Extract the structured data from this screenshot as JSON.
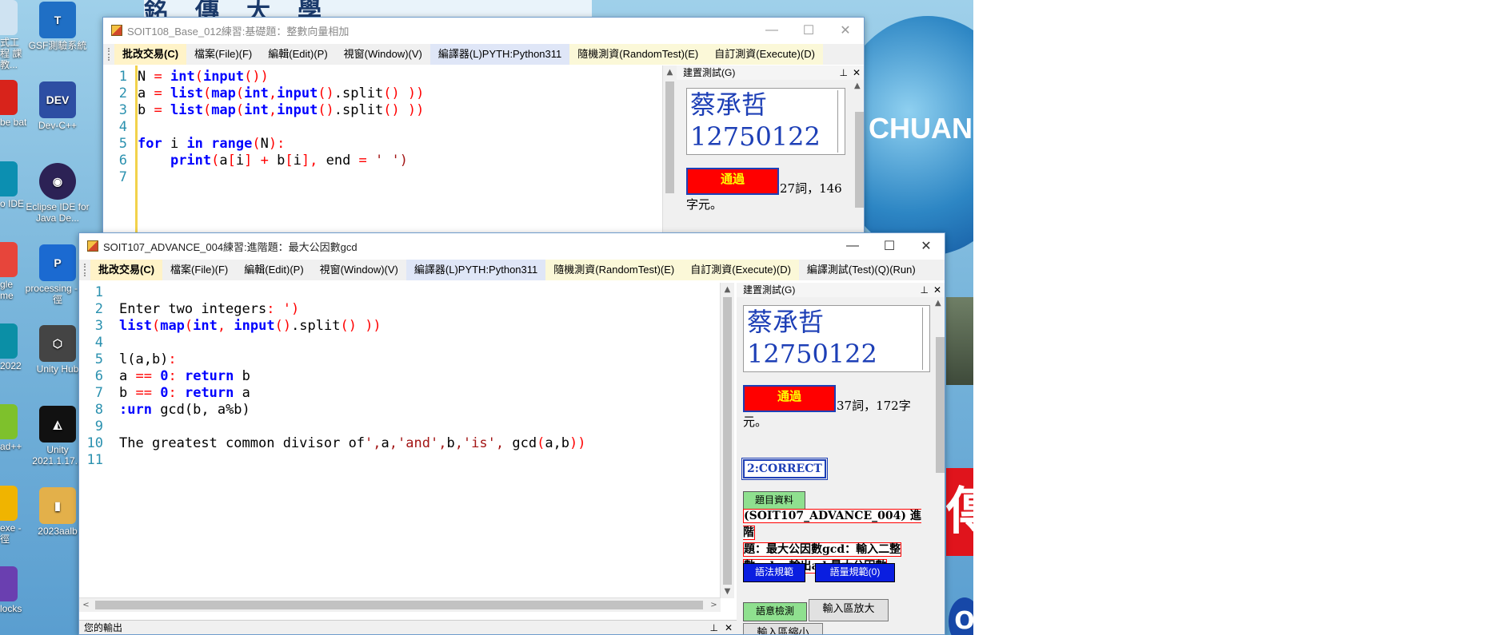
{
  "desktop": {
    "banner": "銘傳大學",
    "globe_text": "CHUAN",
    "red_glyph": "傳",
    "blue_circle_text": "O",
    "icons": [
      {
        "label": "GSF測驗系統",
        "color": "#1f6fc5",
        "glyph": "T"
      },
      {
        "label": "Dev-C++",
        "color": "#2d4ea3",
        "glyph": "DEV"
      },
      {
        "label": "Eclipse IDE for Java De...",
        "color": "#2c2255",
        "glyph": "◉"
      },
      {
        "label": "processing - 捷徑",
        "color": "#1b6ad1",
        "glyph": "P"
      },
      {
        "label": "Unity Hub",
        "color": "#444444",
        "glyph": "⬡"
      },
      {
        "label": "Unity 2021.1.17...",
        "color": "#111111",
        "glyph": "◭"
      },
      {
        "label": "2023aalb",
        "color": "#e3b04a",
        "glyph": "▮"
      }
    ],
    "left_icons": [
      {
        "label": "式工程 課教...",
        "color": "#cfe3f2"
      },
      {
        "label": "be bat",
        "color": "#d8231b"
      },
      {
        "label": "o IDE",
        "color": "#0c8fb1"
      },
      {
        "label": "gle me",
        "color": "#e7453b"
      },
      {
        "label": "2022",
        "color": "#0b8fa6"
      },
      {
        "label": "ad++",
        "color": "#7ec12c"
      },
      {
        "label": "exe - 徑",
        "color": "#f0b400"
      },
      {
        "label": "locks",
        "color": "#6a3fb0"
      }
    ]
  },
  "window1": {
    "title": "SOIT108_Base_012練習:基礎題：整數向量相加",
    "controls": {
      "minimize": "—",
      "maximize": "☐",
      "close": "✕"
    },
    "menu": [
      "批改交易(C)",
      "檔案(File)(F)",
      "編輯(Edit)(P)",
      "視窗(Window)(V)",
      "編譯器(L)PYTH:Python311",
      "隨機測資(RandomTest)(E)",
      "自訂測資(Execute)(D)"
    ],
    "line_numbers": [
      "1",
      "2",
      "3",
      "4",
      "5",
      "6",
      "7"
    ],
    "code_lines": [
      [
        {
          "t": "N ",
          "c": "plain"
        },
        {
          "t": "=",
          "c": "op"
        },
        {
          "t": " ",
          "c": "plain"
        },
        {
          "t": "int",
          "c": "kw"
        },
        {
          "t": "(",
          "c": "op"
        },
        {
          "t": "input",
          "c": "kw"
        },
        {
          "t": "())",
          "c": "op"
        }
      ],
      [
        {
          "t": "a ",
          "c": "plain"
        },
        {
          "t": "=",
          "c": "op"
        },
        {
          "t": " ",
          "c": "plain"
        },
        {
          "t": "list",
          "c": "kw"
        },
        {
          "t": "(",
          "c": "op"
        },
        {
          "t": "map",
          "c": "kw"
        },
        {
          "t": "(",
          "c": "op"
        },
        {
          "t": "int",
          "c": "kw"
        },
        {
          "t": ",",
          "c": "op"
        },
        {
          "t": "input",
          "c": "kw"
        },
        {
          "t": "()",
          "c": "op"
        },
        {
          "t": ".split",
          "c": "plain"
        },
        {
          "t": "() ))",
          "c": "op"
        }
      ],
      [
        {
          "t": "b ",
          "c": "plain"
        },
        {
          "t": "=",
          "c": "op"
        },
        {
          "t": " ",
          "c": "plain"
        },
        {
          "t": "list",
          "c": "kw"
        },
        {
          "t": "(",
          "c": "op"
        },
        {
          "t": "map",
          "c": "kw"
        },
        {
          "t": "(",
          "c": "op"
        },
        {
          "t": "int",
          "c": "kw"
        },
        {
          "t": ",",
          "c": "op"
        },
        {
          "t": "input",
          "c": "kw"
        },
        {
          "t": "()",
          "c": "op"
        },
        {
          "t": ".split",
          "c": "plain"
        },
        {
          "t": "() ))",
          "c": "op"
        }
      ],
      [],
      [
        {
          "t": "for",
          "c": "kw"
        },
        {
          "t": " i ",
          "c": "plain"
        },
        {
          "t": "in",
          "c": "kw"
        },
        {
          "t": " ",
          "c": "plain"
        },
        {
          "t": "range",
          "c": "kw"
        },
        {
          "t": "(",
          "c": "op"
        },
        {
          "t": "N",
          "c": "plain"
        },
        {
          "t": "):",
          "c": "op"
        }
      ],
      [
        {
          "t": "    ",
          "c": "plain"
        },
        {
          "t": "print",
          "c": "kw"
        },
        {
          "t": "(",
          "c": "op"
        },
        {
          "t": "a",
          "c": "plain"
        },
        {
          "t": "[",
          "c": "op"
        },
        {
          "t": "i",
          "c": "plain"
        },
        {
          "t": "]",
          "c": "op"
        },
        {
          "t": " ",
          "c": "plain"
        },
        {
          "t": "+",
          "c": "op"
        },
        {
          "t": " b",
          "c": "plain"
        },
        {
          "t": "[",
          "c": "op"
        },
        {
          "t": "i",
          "c": "plain"
        },
        {
          "t": "],",
          "c": "op"
        },
        {
          "t": " end ",
          "c": "plain"
        },
        {
          "t": "=",
          "c": "op"
        },
        {
          "t": " ",
          "c": "plain"
        },
        {
          "t": "' ')",
          "c": "st"
        }
      ],
      []
    ],
    "panel_title": "建置測試(G)",
    "pin": "📌",
    "panel_close": "✕",
    "student_name": "蔡承哲",
    "student_id": "12750122",
    "pass_label": "通過",
    "stat_text": "27詞，146字元。"
  },
  "window2": {
    "title": "SOIT107_ADVANCE_004練習:進階題：最大公因數gcd",
    "controls": {
      "minimize": "—",
      "maximize": "☐",
      "close": "✕"
    },
    "menu": [
      "批改交易(C)",
      "檔案(File)(F)",
      "編輯(Edit)(P)",
      "視窗(Window)(V)",
      "編譯器(L)PYTH:Python311",
      "隨機測資(RandomTest)(E)",
      "自訂測資(Execute)(D)",
      "編譯測試(Test)(Q)(Run)"
    ],
    "line_numbers": [
      "1",
      "2",
      "3",
      "4",
      "5",
      "6",
      "7",
      "8",
      "9",
      "10",
      "11"
    ],
    "code_lines": [
      [],
      [
        {
          "t": "Enter two integers",
          "c": "plain"
        },
        {
          "t": ": ')",
          "c": "op"
        }
      ],
      [
        {
          "t": "list",
          "c": "kw"
        },
        {
          "t": "(",
          "c": "op"
        },
        {
          "t": "map",
          "c": "kw"
        },
        {
          "t": "(",
          "c": "op"
        },
        {
          "t": "int",
          "c": "kw"
        },
        {
          "t": ",",
          "c": "op"
        },
        {
          "t": " ",
          "c": "plain"
        },
        {
          "t": "input",
          "c": "kw"
        },
        {
          "t": "()",
          "c": "op"
        },
        {
          "t": ".split",
          "c": "plain"
        },
        {
          "t": "() ))",
          "c": "op"
        }
      ],
      [],
      [
        {
          "t": "l(a,b)",
          "c": "plain"
        },
        {
          "t": ":",
          "c": "op"
        }
      ],
      [
        {
          "t": "a ",
          "c": "plain"
        },
        {
          "t": "==",
          "c": "op"
        },
        {
          "t": " ",
          "c": "plain"
        },
        {
          "t": "0",
          "c": "kw"
        },
        {
          "t": ":",
          "c": "op"
        },
        {
          "t": " ",
          "c": "plain"
        },
        {
          "t": "return",
          "c": "kw"
        },
        {
          "t": " b",
          "c": "plain"
        }
      ],
      [
        {
          "t": "b ",
          "c": "plain"
        },
        {
          "t": "==",
          "c": "op"
        },
        {
          "t": " ",
          "c": "plain"
        },
        {
          "t": "0",
          "c": "kw"
        },
        {
          "t": ":",
          "c": "op"
        },
        {
          "t": " ",
          "c": "plain"
        },
        {
          "t": "return",
          "c": "kw"
        },
        {
          "t": " a",
          "c": "plain"
        }
      ],
      [
        {
          "t": ":urn",
          "c": "kw"
        },
        {
          "t": " gcd(b, a%b)",
          "c": "plain"
        }
      ],
      [],
      [
        {
          "t": "The greatest common divisor of",
          "c": "plain"
        },
        {
          "t": "',",
          "c": "st"
        },
        {
          "t": "a",
          "c": "plain"
        },
        {
          "t": ",'and',",
          "c": "st"
        },
        {
          "t": "b",
          "c": "plain"
        },
        {
          "t": ",'is',",
          "c": "st"
        },
        {
          "t": " gcd",
          "c": "plain"
        },
        {
          "t": "(",
          "c": "op"
        },
        {
          "t": "a,b",
          "c": "plain"
        },
        {
          "t": "))",
          "c": "op"
        }
      ],
      []
    ],
    "panel_title": "建置測試(G)",
    "pin": "📌",
    "panel_close": "✕",
    "student_name": "蔡承哲",
    "student_id": "12750122",
    "pass_label": "通過",
    "stat_text": "37詞，172字元。",
    "correct_label": "2:CORRECT",
    "problem_data_btn": "題目資料",
    "problem_lines": [
      "(SOIT107_ADVANCE_004) 進階",
      "題：最大公因數gcd：輸入二整",
      "數 a b，輸出a b最大公因數"
    ],
    "syntax_btn": "語法規範",
    "vocab_btn": "語量規範(0)",
    "semantic_btn": "語意檢測",
    "zoom_in_btn": "輸入區放大",
    "zoom_out_btn": "輸入區縮小",
    "output_panel_title": "您的輸出",
    "hscroll_left": "<",
    "hscroll_right": ">"
  }
}
